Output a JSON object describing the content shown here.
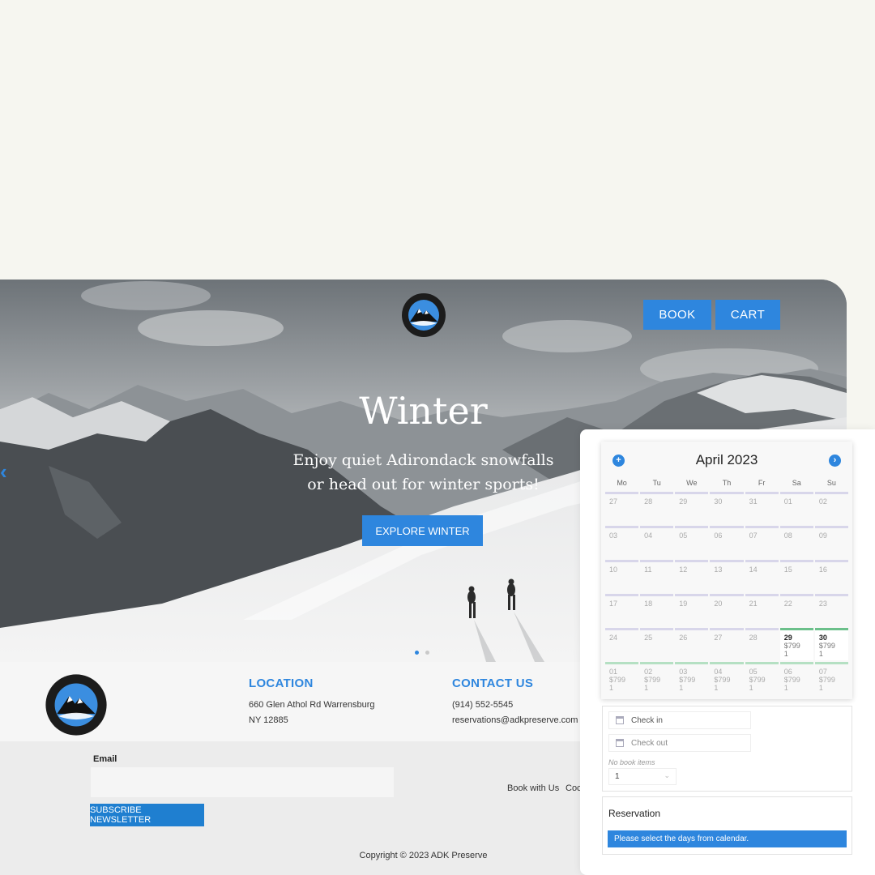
{
  "brand": {
    "logo_top": "ADK PRESERVE",
    "logo_bottom": "UPSTATE NEW YORK"
  },
  "header": {
    "book_label": "BOOK",
    "cart_label": "CART"
  },
  "hero": {
    "title": "Winter",
    "subtitle_line1": "Enjoy quiet Adirondack snowfalls",
    "subtitle_line2": "or head out for winter sports!",
    "cta_label": "EXPLORE WINTER",
    "prev_arrow": "‹",
    "slides_total": 2,
    "active_slide": 1
  },
  "footer": {
    "location": {
      "heading": "LOCATION",
      "line1": "660 Glen Athol Rd Warrensburg",
      "line2": "NY 12885"
    },
    "contact": {
      "heading": "CONTACT US",
      "phone": "(914) 552-5545",
      "email": "reservations@adkpreserve.com"
    },
    "newsletter": {
      "email_label": "Email",
      "email_value": "",
      "subscribe_label": "SUBSCRIBE NEWSLETTER"
    },
    "links": [
      "Book with Us",
      "Coc"
    ],
    "copyright": "Copyright © 2023 ADK Preserve"
  },
  "booking": {
    "calendar": {
      "title": "April 2023",
      "prev_icon": "+",
      "next_icon": "›",
      "weekdays": [
        "Mo",
        "Tu",
        "We",
        "Th",
        "Fr",
        "Sa",
        "Su"
      ],
      "days": [
        {
          "d": "27",
          "state": "off"
        },
        {
          "d": "28",
          "state": "off"
        },
        {
          "d": "29",
          "state": "off"
        },
        {
          "d": "30",
          "state": "off"
        },
        {
          "d": "31",
          "state": "off"
        },
        {
          "d": "01",
          "state": "off"
        },
        {
          "d": "02",
          "state": "off"
        },
        {
          "d": "03",
          "state": "off"
        },
        {
          "d": "04",
          "state": "off"
        },
        {
          "d": "05",
          "state": "off"
        },
        {
          "d": "06",
          "state": "off"
        },
        {
          "d": "07",
          "state": "off"
        },
        {
          "d": "08",
          "state": "off"
        },
        {
          "d": "09",
          "state": "off"
        },
        {
          "d": "10",
          "state": "off"
        },
        {
          "d": "11",
          "state": "off"
        },
        {
          "d": "12",
          "state": "off"
        },
        {
          "d": "13",
          "state": "off"
        },
        {
          "d": "14",
          "state": "off"
        },
        {
          "d": "15",
          "state": "off"
        },
        {
          "d": "16",
          "state": "off"
        },
        {
          "d": "17",
          "state": "off"
        },
        {
          "d": "18",
          "state": "off"
        },
        {
          "d": "19",
          "state": "off"
        },
        {
          "d": "20",
          "state": "off"
        },
        {
          "d": "21",
          "state": "off"
        },
        {
          "d": "22",
          "state": "off"
        },
        {
          "d": "23",
          "state": "off"
        },
        {
          "d": "24",
          "state": "off"
        },
        {
          "d": "25",
          "state": "off"
        },
        {
          "d": "26",
          "state": "off"
        },
        {
          "d": "27",
          "state": "off"
        },
        {
          "d": "28",
          "state": "off"
        },
        {
          "d": "29",
          "state": "avail",
          "price": "$799",
          "qty": "1"
        },
        {
          "d": "30",
          "state": "avail",
          "price": "$799",
          "qty": "1"
        },
        {
          "d": "01",
          "state": "next",
          "price": "$799",
          "qty": "1"
        },
        {
          "d": "02",
          "state": "next",
          "price": "$799",
          "qty": "1"
        },
        {
          "d": "03",
          "state": "next",
          "price": "$799",
          "qty": "1"
        },
        {
          "d": "04",
          "state": "next",
          "price": "$799",
          "qty": "1"
        },
        {
          "d": "05",
          "state": "next",
          "price": "$799",
          "qty": "1"
        },
        {
          "d": "06",
          "state": "next",
          "price": "$799",
          "qty": "1"
        },
        {
          "d": "07",
          "state": "next",
          "price": "$799",
          "qty": "1"
        }
      ]
    },
    "check_in_placeholder": "Check in",
    "check_out_placeholder": "Check out",
    "no_items_text": "No book items",
    "quantity_value": "1",
    "reservation_title": "Reservation",
    "reservation_message": "Please select the days from calendar."
  },
  "colors": {
    "accent": "#2e86de",
    "available": "#6cc08b",
    "unavailable": "#d8d6ea"
  }
}
